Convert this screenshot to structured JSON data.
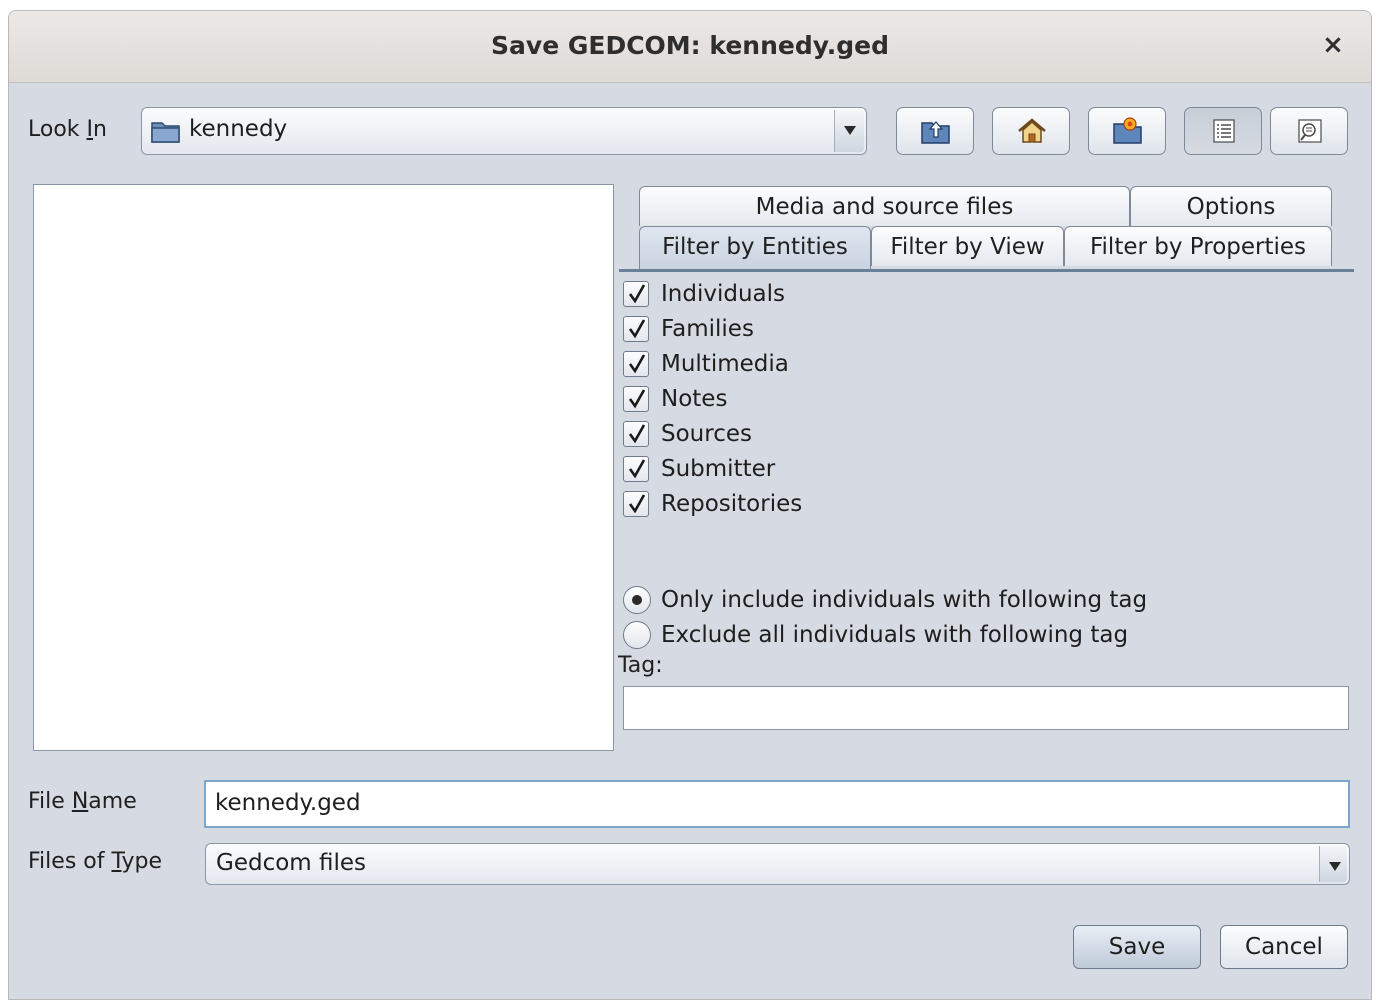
{
  "window": {
    "title": "Save GEDCOM: kennedy.ged",
    "close_label": "×"
  },
  "look_in": {
    "label_pre": "Look ",
    "label_mnemonic": "I",
    "label_post": "n",
    "value": "kennedy",
    "folder_icon": "folder-icon"
  },
  "toolbar": {
    "buttons": [
      {
        "name": "up-one-level",
        "icon": "folder-up-icon"
      },
      {
        "name": "home",
        "icon": "home-icon"
      },
      {
        "name": "new-folder",
        "icon": "new-folder-icon"
      },
      {
        "name": "list-view",
        "icon": "list-view-icon",
        "pressed": true
      },
      {
        "name": "details-view",
        "icon": "details-view-icon"
      }
    ]
  },
  "tabs": {
    "row1": [
      "Media and source files",
      "Options"
    ],
    "row2": [
      "Filter by Entities",
      "Filter by View",
      "Filter by Properties"
    ],
    "selected": "Filter by Entities"
  },
  "entities": [
    {
      "label": "Individuals",
      "checked": true
    },
    {
      "label": "Families",
      "checked": true
    },
    {
      "label": "Multimedia",
      "checked": true
    },
    {
      "label": "Notes",
      "checked": true
    },
    {
      "label": "Sources",
      "checked": true
    },
    {
      "label": "Submitter",
      "checked": true
    },
    {
      "label": "Repositories",
      "checked": true
    }
  ],
  "tag_filter": {
    "include_label": "Only include individuals with following tag",
    "exclude_label": "Exclude all individuals with following tag",
    "selected": "include",
    "tag_label": "Tag:",
    "tag_value": ""
  },
  "file_name": {
    "label_pre": "File ",
    "label_mnemonic": "N",
    "label_post": "ame",
    "value": "kennedy.ged"
  },
  "file_type": {
    "label_pre": "Files of ",
    "label_mnemonic": "T",
    "label_post": "ype",
    "value": "Gedcom files"
  },
  "actions": {
    "save_label": "Save",
    "cancel_label": "Cancel"
  },
  "colors": {
    "dialog_bg": "#d6dae2",
    "titlebar_bg": "#e4e1de",
    "focus_border": "#7ea6cf"
  }
}
